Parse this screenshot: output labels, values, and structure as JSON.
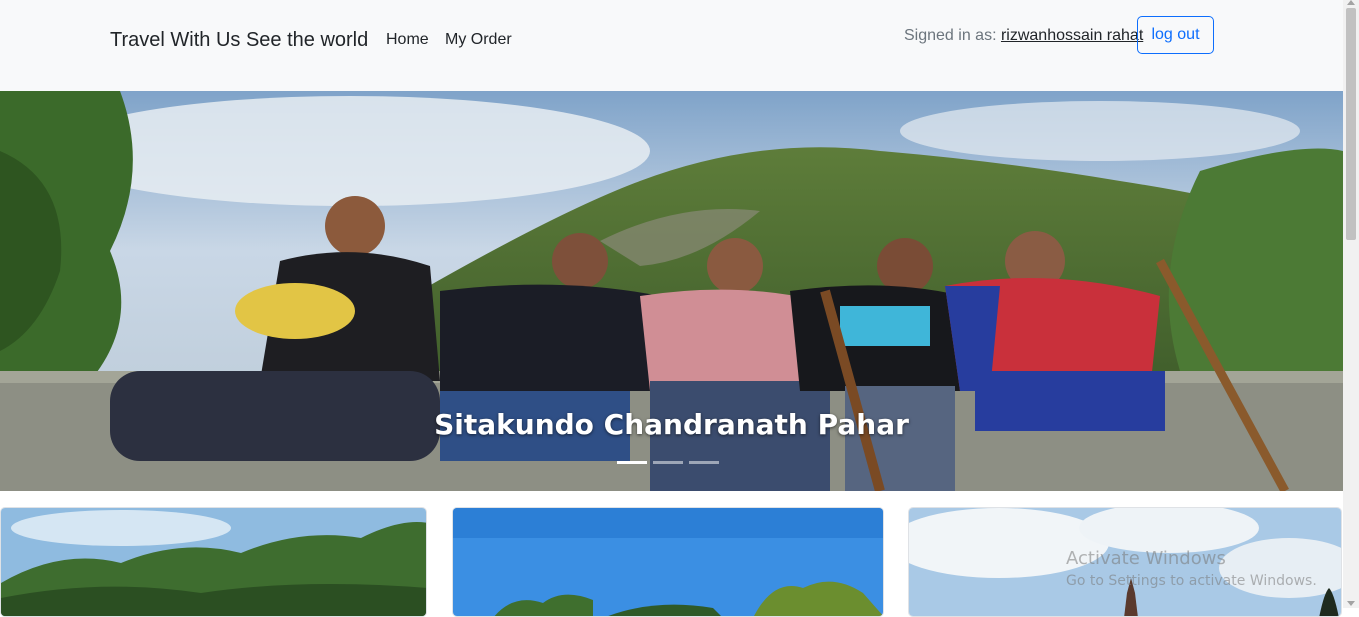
{
  "navbar": {
    "brand": "Travel With Us See the world",
    "links": [
      "Home",
      "My Order"
    ],
    "signed_in_prefix": "Signed in as:",
    "username": "rizwanhossain rahat",
    "logout_label": "log out"
  },
  "carousel": {
    "caption": "Sitakundo Chandranath Pahar",
    "slide_count": 3,
    "active_index": 0
  },
  "cards": [
    {
      "image": "forest-landscape-image"
    },
    {
      "image": "blue-sky-trees-image"
    },
    {
      "image": "cloudy-sky-temple-image"
    }
  ],
  "watermark": {
    "title": "Activate Windows",
    "subtitle": "Go to Settings to activate Windows."
  },
  "colors": {
    "navbar_bg": "#f8f9fa",
    "primary": "#0d6efd"
  }
}
